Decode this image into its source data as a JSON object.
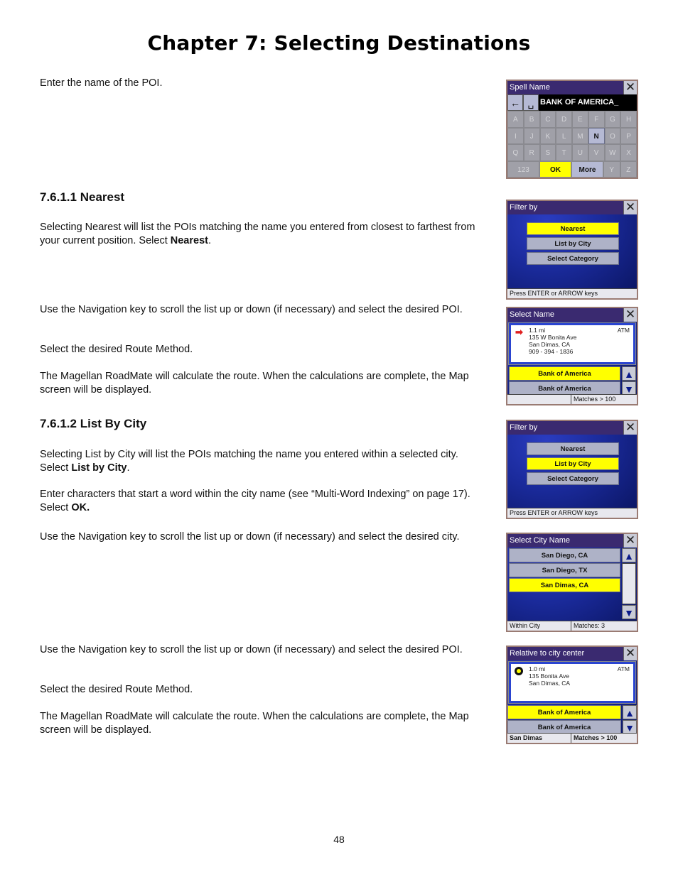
{
  "chapter_title": "Chapter 7: Selecting Destinations",
  "page_number": "48",
  "intro": "Enter the name of the POI.",
  "sections": [
    {
      "heading": "7.6.1.1 Nearest",
      "paragraphs": [
        {
          "before": "Selecting Nearest will list the POIs matching the name you entered from closest to farthest from your current position. Select ",
          "bold": "Nearest",
          "after": "."
        },
        {
          "text": "Use the Navigation key to scroll the list up or down (if necessary) and select the desired POI."
        },
        {
          "text": "Select the desired Route Method."
        },
        {
          "text": "The Magellan RoadMate will calculate the route. When the calculations are complete, the Map screen will be displayed."
        }
      ]
    },
    {
      "heading": "7.6.1.2 List By City",
      "paragraphs": [
        {
          "before": "Selecting List by City will list the POIs matching the name you entered within a selected city. Select ",
          "bold": "List by City",
          "after": "."
        },
        {
          "before": "Enter characters that start a word within the city name (see “Multi-Word Indexing” on page 17). Select ",
          "bold": "OK.",
          "after": ""
        },
        {
          "text": "Use the Navigation key to scroll the list up or down (if necessary) and select the desired city."
        },
        {
          "text": "Use the Navigation key to scroll the list up or down (if necessary) and select the desired POI."
        },
        {
          "text": "Select the desired Route Method."
        },
        {
          "text": "The Magellan RoadMate will calculate the route. When the calculations are complete, the Map screen will be displayed."
        }
      ]
    }
  ],
  "screens": {
    "spell_name": {
      "title": "Spell Name",
      "input_value": "BANK OF AMERICA_",
      "backspace_icon": "←",
      "space_icon": "␣",
      "rows": [
        [
          "A",
          "B",
          "C",
          "D",
          "E",
          "F",
          "G",
          "H"
        ],
        [
          "I",
          "J",
          "K",
          "L",
          "M",
          "N",
          "O",
          "P"
        ],
        [
          "Q",
          "R",
          "S",
          "T",
          "U",
          "V",
          "W",
          "X"
        ]
      ],
      "active_key": "N",
      "bottom_keys": {
        "num": "123",
        "ok": "OK",
        "more": "More",
        "y": "Y",
        "z": "Z"
      }
    },
    "filter_nearest": {
      "title": "Filter by",
      "options": [
        "Nearest",
        "List by City",
        "Select Category"
      ],
      "selected": "Nearest",
      "status": "Press ENTER or ARROW keys"
    },
    "select_name": {
      "title": "Select Name",
      "distance": "1.1 mi",
      "type": "ATM",
      "address": "135 W Bonita Ave",
      "city": "San Dimas, CA",
      "phone": "909 - 394 - 1836",
      "items": [
        "Bank of America",
        "Bank of America"
      ],
      "status_left": "",
      "status_right": "Matches > 100"
    },
    "filter_city": {
      "title": "Filter by",
      "options": [
        "Nearest",
        "List by City",
        "Select Category"
      ],
      "selected": "List by City",
      "status": "Press ENTER or ARROW keys"
    },
    "select_city": {
      "title": "Select City Name",
      "items": [
        "San Diego, CA",
        "San Diego, TX",
        "San Dimas, CA"
      ],
      "selected": "San Dimas, CA",
      "status_left": "Within City",
      "status_right": "Matches:  3"
    },
    "relative_city": {
      "title": "Relative to city center",
      "distance": "1.0 mi",
      "type": "ATM",
      "address": "135 Bonita Ave",
      "city": "San Dimas, CA",
      "items": [
        "Bank of America",
        "Bank of America"
      ],
      "status_left": "San Dimas",
      "status_right": "Matches > 100"
    }
  },
  "colors": {
    "highlight": "#ffff00",
    "titlebar": "#3a2a70",
    "screen_blue": "#1a2a9a",
    "button_gray": "#aeb2c7"
  }
}
